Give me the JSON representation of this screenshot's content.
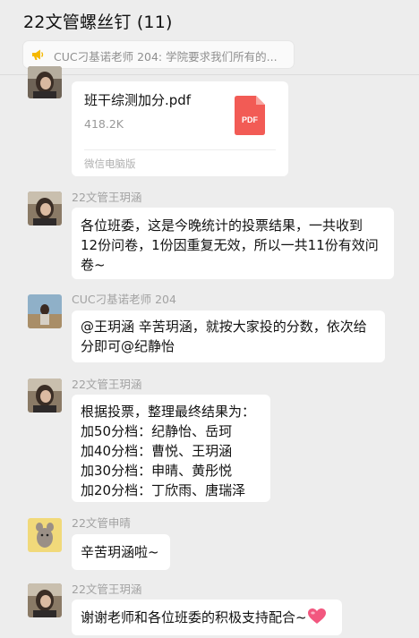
{
  "header": {
    "title": "22文管螺丝钉 (11)"
  },
  "announcement": {
    "icon": "megaphone-icon",
    "text": "CUC刁基诺老师 204: 学院要求我们所有的..."
  },
  "file_message": {
    "file_name": "班干综测加分.pdf",
    "file_size": "418.2K",
    "file_type_label": "PDF",
    "source": "微信电脑版"
  },
  "messages": [
    {
      "sender": "22文管王玥涵",
      "lines": [
        "各位班委，这是今晚统计的投票结果，一共收到",
        "12份问卷，1份因重复无效，所以一共11份有效问",
        "卷~"
      ]
    },
    {
      "sender": "CUC刁基诺老师 204",
      "lines": [
        "@王玥涵 辛苦玥涵，就按大家投的分数，依次给",
        "分即可@纪静怡"
      ]
    },
    {
      "sender": "22文管王玥涵",
      "lines": [
        "根据投票，整理最终结果为：",
        "加50分档：纪静怡、岳珂",
        "加40分档：曹悦、王玥涵",
        "加30分档：申晴、黄彤悦",
        "加20分档：丁欣雨、唐瑞泽"
      ]
    },
    {
      "sender": "22文管申晴",
      "lines": [
        "辛苦玥涵啦~"
      ]
    },
    {
      "sender": "22文管王玥涵",
      "lines": [
        "谢谢老师和各位班委的积极支持配合~"
      ],
      "emoji": "heart-emoji-icon"
    }
  ],
  "colors": {
    "background": "#ededed",
    "bubble": "#ffffff",
    "pdf_red": "#f25b55",
    "heart": "#f2577f"
  }
}
